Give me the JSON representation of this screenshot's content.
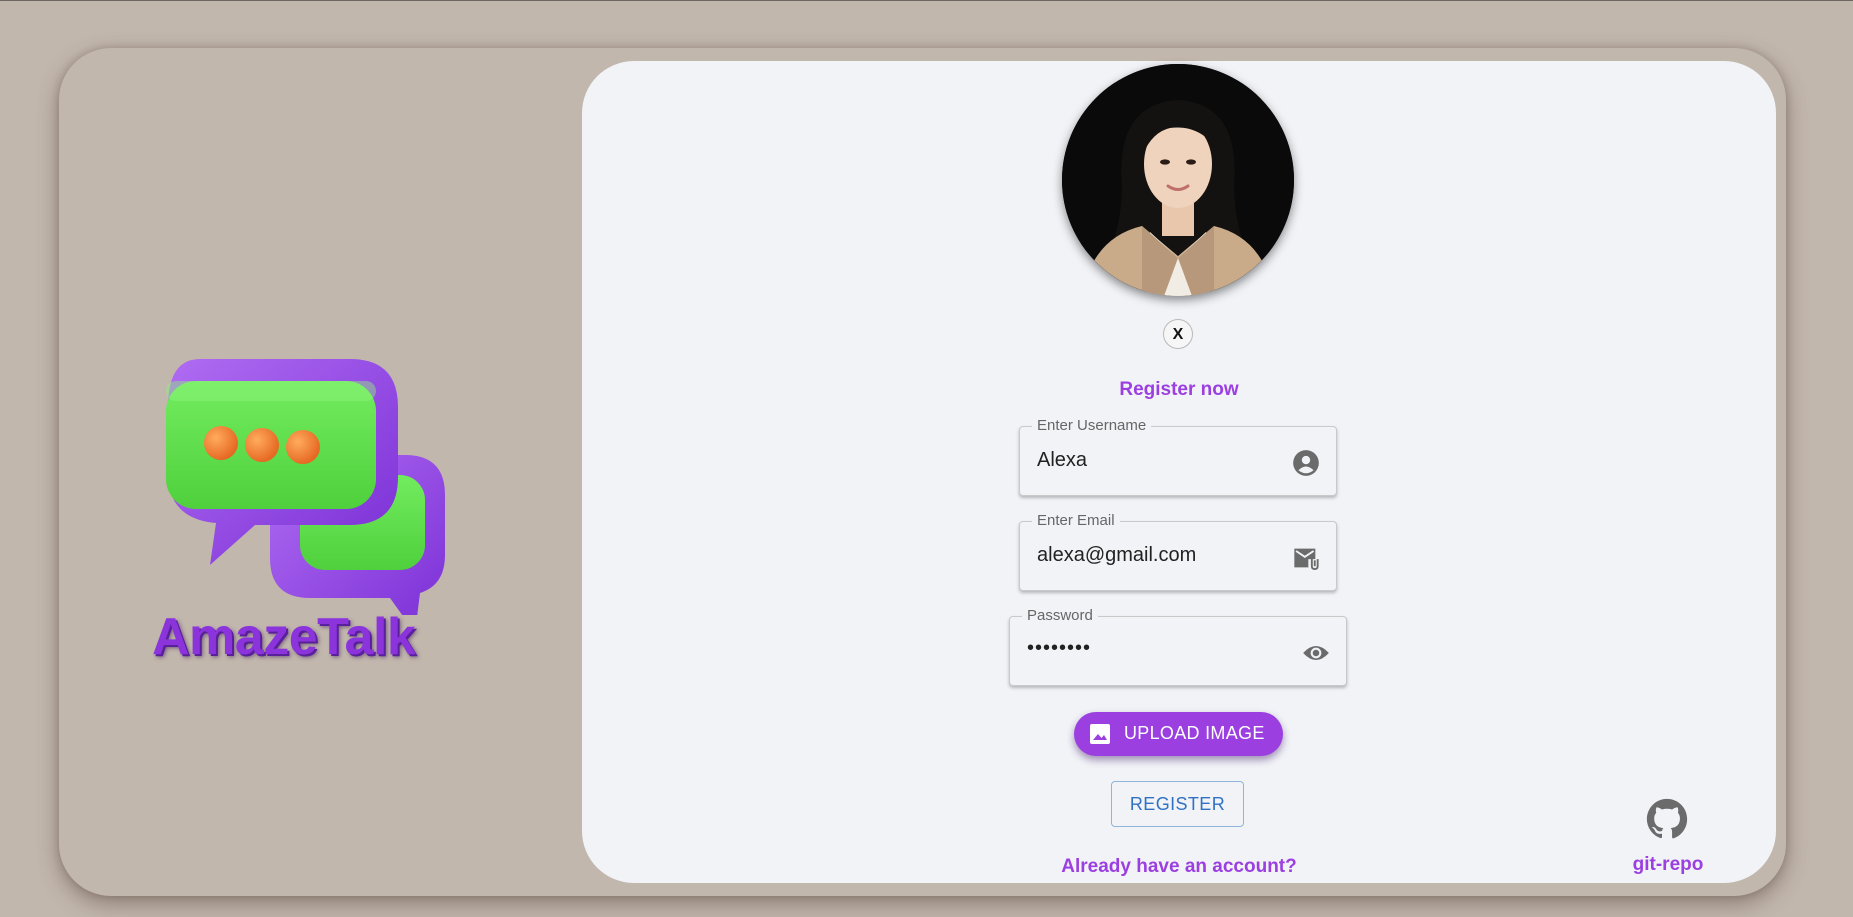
{
  "brand": {
    "name": "AmazeTalk",
    "logo_icon": "chat-bubbles-icon"
  },
  "avatar": {
    "alt": "profile-photo"
  },
  "remove_button": {
    "label": "X"
  },
  "heading": "Register now",
  "form": {
    "username": {
      "label": "Enter Username",
      "value": "Alexa",
      "icon": "account-circle-icon"
    },
    "email": {
      "label": "Enter Email",
      "value": "alexa@gmail.com",
      "icon": "mail-attachment-icon"
    },
    "password": {
      "label": "Password",
      "value": "••••••••",
      "icon": "eye-icon"
    }
  },
  "buttons": {
    "upload": "UPLOAD IMAGE",
    "register": "REGISTER"
  },
  "login_link": "Already have an account?",
  "git_repo": {
    "label": "git-repo",
    "icon": "github-icon"
  },
  "colors": {
    "background": "#c2b7ad",
    "card": "#f1f3f7",
    "accent": "#9b3fe0",
    "register_text": "#2f72c4"
  }
}
